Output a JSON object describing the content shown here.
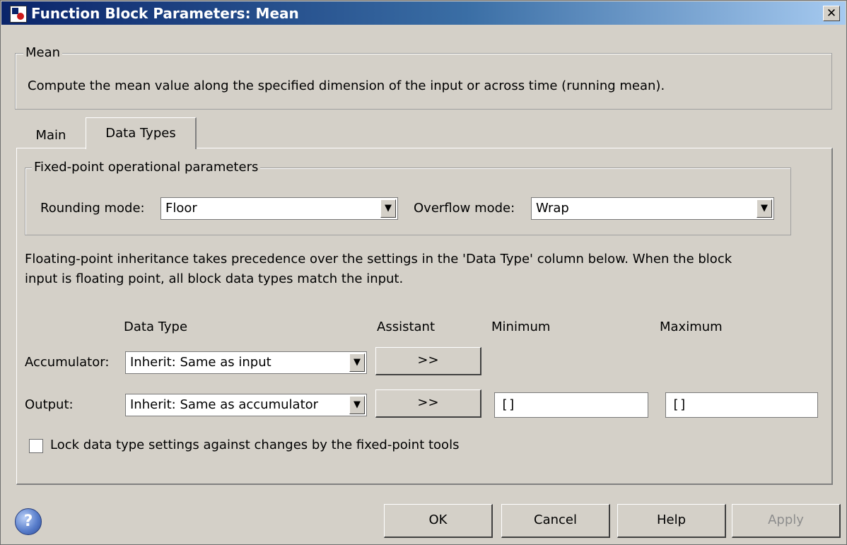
{
  "window": {
    "title": "Function Block Parameters: Mean",
    "close_glyph": "✕"
  },
  "description_group": {
    "legend": "Mean",
    "text": "Compute the mean value along the specified dimension of the input or across time (running mean)."
  },
  "tabs": [
    {
      "label": "Main",
      "active": false
    },
    {
      "label": "Data Types",
      "active": true
    }
  ],
  "fixed_point": {
    "legend": "Fixed-point operational parameters",
    "rounding_label": "Rounding mode:",
    "rounding_value": "Floor",
    "overflow_label": "Overflow mode:",
    "overflow_value": "Wrap"
  },
  "note": {
    "line1": "Floating-point inheritance takes precedence over the settings in the 'Data Type' column below. When the block",
    "line2": "input is floating point, all block data types match the input."
  },
  "table": {
    "headers": {
      "data_type": "Data Type",
      "assistant": "Assistant",
      "minimum": "Minimum",
      "maximum": "Maximum"
    },
    "rows": {
      "accumulator": {
        "label": "Accumulator:",
        "data_type": "Inherit: Same as input",
        "assistant": ">>"
      },
      "output": {
        "label": "Output:",
        "data_type": "Inherit: Same as accumulator",
        "assistant": ">>",
        "minimum": "[]",
        "maximum": "[]"
      }
    }
  },
  "lock": {
    "label": "Lock data type settings against changes by the fixed-point tools",
    "checked": false
  },
  "buttons": {
    "ok": "OK",
    "cancel": "Cancel",
    "help": "Help",
    "apply": "Apply"
  },
  "help_icon_glyph": "?",
  "dropdown_glyph": "▼"
}
